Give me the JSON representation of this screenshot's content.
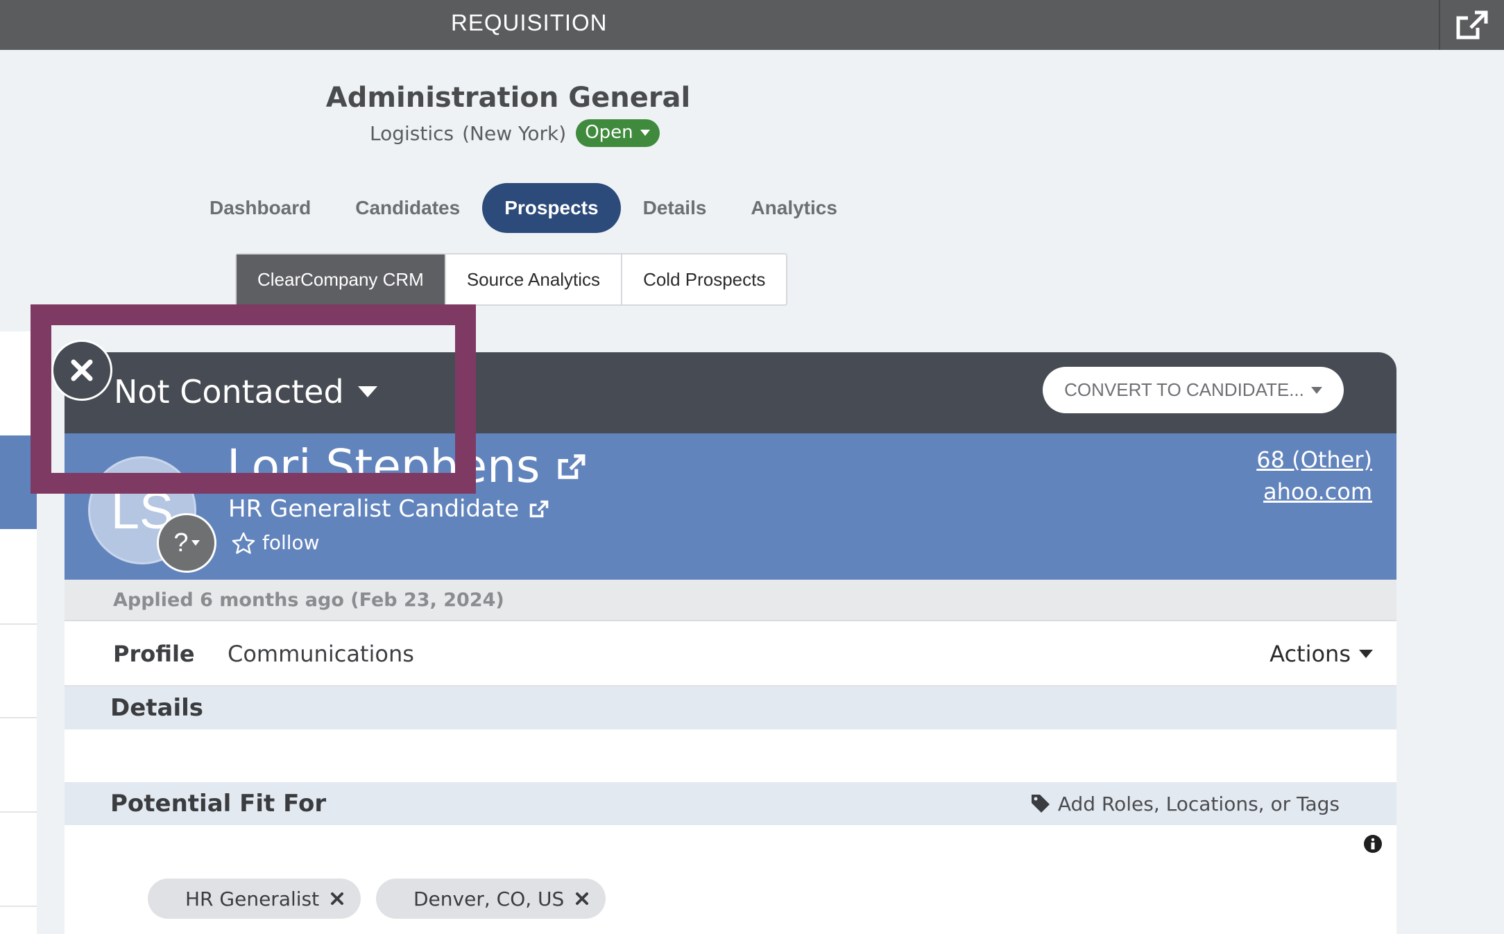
{
  "topbar": {
    "title": "REQUISITION",
    "open_external_icon": "external-link-icon"
  },
  "requisition": {
    "title": "Administration General",
    "department": "Logistics",
    "location": "(New York)",
    "status": "Open",
    "status_color": "#3f8a3c"
  },
  "tabs": [
    {
      "label": "Dashboard",
      "active": false
    },
    {
      "label": "Candidates",
      "active": false
    },
    {
      "label": "Prospects",
      "active": true
    },
    {
      "label": "Details",
      "active": false
    },
    {
      "label": "Analytics",
      "active": false
    }
  ],
  "subtabs": [
    {
      "label": "ClearCompany CRM",
      "active": true
    },
    {
      "label": "Source Analytics",
      "active": false
    },
    {
      "label": "Cold Prospects",
      "active": false
    }
  ],
  "prospect": {
    "stage": "Not Contacted",
    "convert_button": "CONVERT TO CANDIDATE...",
    "initials": "LS",
    "avatar_badge": "?",
    "name": "Lori Stephens",
    "role": "HR Generalist Candidate",
    "follow_label": "follow",
    "phone": "68 (Other)",
    "email": "ahoo.com",
    "applied": "Applied 6 months ago (Feb 23, 2024)"
  },
  "profile_tabs": {
    "profile": "Profile",
    "communications": "Communications",
    "actions": "Actions"
  },
  "sections": {
    "details": "Details",
    "potential_fit": "Potential Fit For",
    "add_tags": "Add Roles, Locations, or Tags"
  },
  "chips": [
    {
      "label": "HR Generalist"
    },
    {
      "label": "Denver, CO, US"
    }
  ],
  "colors": {
    "topbar": "#5b5c5e",
    "accent": "#2c4a7a",
    "card_blue": "#6284bd",
    "overlay": "#7f3a63"
  }
}
